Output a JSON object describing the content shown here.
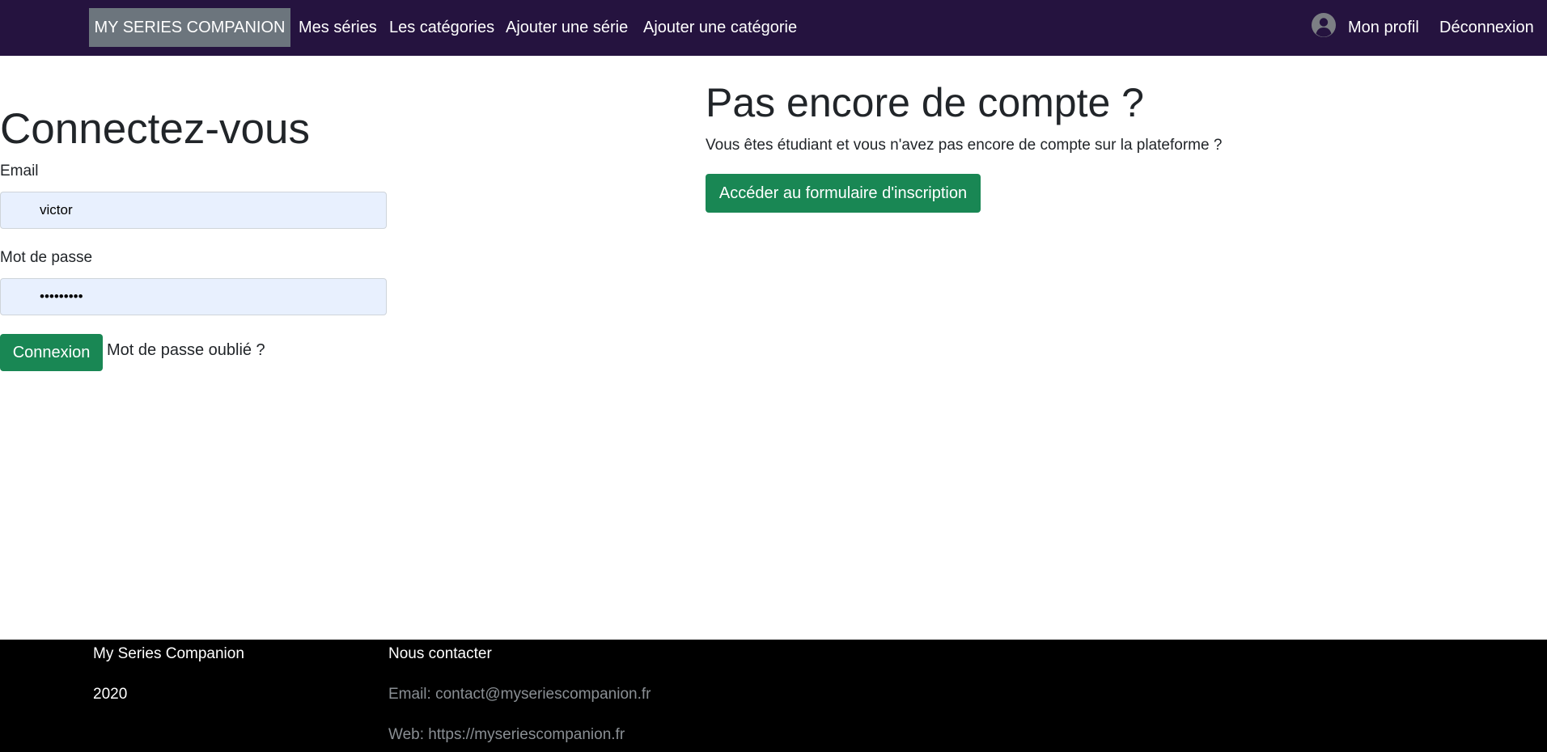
{
  "navbar": {
    "brand": "MY SERIES COMPANION",
    "links": {
      "mes_series": "Mes séries",
      "categories": "Les catégories",
      "ajouter_serie": "Ajouter une série",
      "ajouter_categorie": "Ajouter une catégorie"
    },
    "user_icon": "user-circle-icon",
    "profil": "Mon profil",
    "deconnexion": "Déconnexion",
    "background_color": "#25133f",
    "brand_background_color": "#6c757d"
  },
  "login": {
    "title": "Connectez-vous",
    "email_label": "Email",
    "email_value": "victor",
    "password_label": "Mot de passe",
    "password_value": "•••••••••",
    "submit_label": "Connexion",
    "forgot_label": "Mot de passe oublié ?"
  },
  "register": {
    "title": "Pas encore de compte ?",
    "text": "Vous êtes étudiant et vous n'avez pas encore de compte sur la plateforme ?",
    "button_label": "Accéder au formulaire d'inscription"
  },
  "footer": {
    "brand": "My Series Companion",
    "year": "2020",
    "contact_title": "Nous contacter",
    "email_line": "Email: contact@myseriescompanion.fr",
    "web_line": "Web: https://myseriescompanion.fr"
  },
  "colors": {
    "accent_green": "#198754",
    "input_autofill": "#e8f0fe",
    "footer_background": "#000000"
  }
}
